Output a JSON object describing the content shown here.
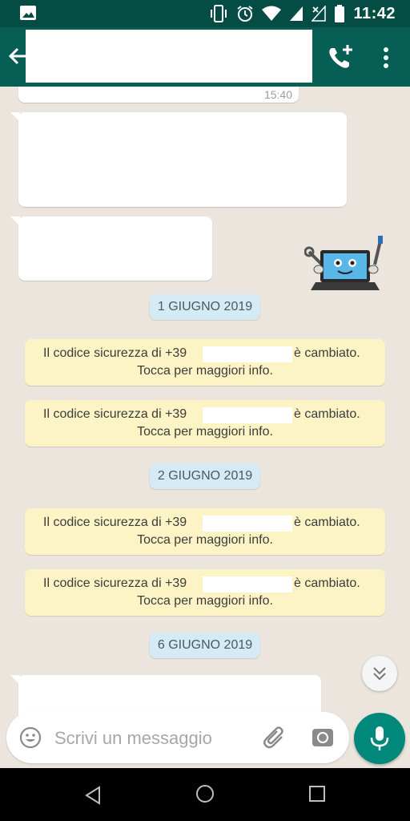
{
  "status_bar": {
    "time": "11:42",
    "icons": [
      "image-icon",
      "vibrate-icon",
      "alarm-icon",
      "wifi-icon",
      "signal-icon",
      "signal-no-data-icon",
      "battery-icon"
    ]
  },
  "app_bar": {
    "icons": [
      "back-arrow-icon",
      "add-call-icon",
      "more-vert-icon"
    ]
  },
  "chat": {
    "first_bubble_time": "15:40",
    "date_chips": [
      "1 GIUGNO 2019",
      "2 GIUGNO 2019",
      "6 GIUGNO 2019"
    ],
    "system_messages": [
      {
        "prefix": "Il codice sicurezza di +39",
        "suffix": "è cambiato.",
        "line2": "Tocca per maggiori info."
      },
      {
        "prefix": "Il codice sicurezza di +39",
        "suffix": "è cambiato.",
        "line2": "Tocca per maggiori info."
      },
      {
        "prefix": "Il codice sicurezza di +39",
        "suffix": "è cambiato.",
        "line2": "Tocca per maggiori info."
      },
      {
        "prefix": "Il codice sicurezza di +39",
        "suffix": "è cambiato.",
        "line2": "Tocca per maggiori info."
      }
    ],
    "sticker": "laptop-robot-sticker"
  },
  "input": {
    "placeholder": "Scrivi un messaggio",
    "icons": [
      "emoji-icon",
      "attach-icon",
      "camera-icon",
      "mic-icon"
    ]
  },
  "colors": {
    "status_bar": "#054d44",
    "app_bar": "#075e54",
    "chat_bg": "#ece5dd",
    "system_msg": "#fcf4c4",
    "date_chip": "#d4eaf4",
    "mic_button": "#00897b"
  }
}
